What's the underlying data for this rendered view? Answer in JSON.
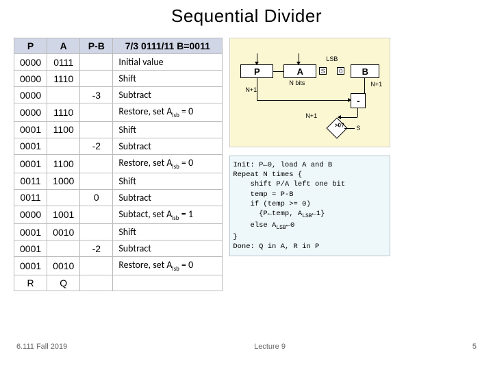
{
  "title": "Sequential Divider",
  "table": {
    "headers": {
      "p": "P",
      "a": "A",
      "pb": "P-B",
      "desc": "7/3  0111/11  B=0011"
    },
    "rows": [
      {
        "p": "0000",
        "a": "0111",
        "pb": "",
        "desc": "Initial value"
      },
      {
        "p": "0000",
        "a": "1110",
        "pb": "",
        "desc": "Shift"
      },
      {
        "p": "0000",
        "a": "",
        "pb": "-3",
        "desc": "Subtract"
      },
      {
        "p": "0000",
        "a": "1110",
        "pb": "",
        "desc": "Restore, set A_lsb = 0"
      },
      {
        "p": "0001",
        "a": "1100",
        "pb": "",
        "desc": "Shift"
      },
      {
        "p": "0001",
        "a": "",
        "pb": "-2",
        "desc": "Subtract"
      },
      {
        "p": "0001",
        "a": "1100",
        "pb": "",
        "desc": "Restore, set A_lsb = 0"
      },
      {
        "p": "0011",
        "a": "1000",
        "pb": "",
        "desc": "Shift"
      },
      {
        "p": "0011",
        "a": "",
        "pb": "0",
        "desc": "Subtract"
      },
      {
        "p": "0000",
        "a": "1001",
        "pb": "",
        "desc": "Subtact, set A_lsb = 1"
      },
      {
        "p": "0001",
        "a": "0010",
        "pb": "",
        "desc": "Shift"
      },
      {
        "p": "0001",
        "a": "",
        "pb": "-2",
        "desc": "Subtract"
      },
      {
        "p": "0001",
        "a": "0010",
        "pb": "",
        "desc": "Restore, set A_lsb = 0"
      },
      {
        "p": "R",
        "a": "Q",
        "pb": "",
        "desc": ""
      }
    ]
  },
  "diagram": {
    "boxes": {
      "P": "P",
      "A": "A",
      "B": "B"
    },
    "labels": {
      "lsb": "LSB",
      "s": "S",
      "zero": "0",
      "nbits": "N bits",
      "np1a": "N+1",
      "np1b": "N+1",
      "np1c": "N+1",
      "minus": "-",
      "gt0": ">0?"
    }
  },
  "algorithm": {
    "l1": "Init: P←0, load A and B",
    "l2": "Repeat N times {",
    "l3": "    shift P/A left one bit",
    "l4": "    temp = P-B",
    "l5": "    if (temp >= 0)",
    "l6a": "      {P←temp, A",
    "l6b": "←1}",
    "l7a": "    else A",
    "l7b": "←0",
    "l8": "}",
    "l9": "Done: Q in A, R in P",
    "sub": "LSB"
  },
  "footer": {
    "left": "6.111 Fall 2019",
    "center": "Lecture 9",
    "right": "5"
  }
}
